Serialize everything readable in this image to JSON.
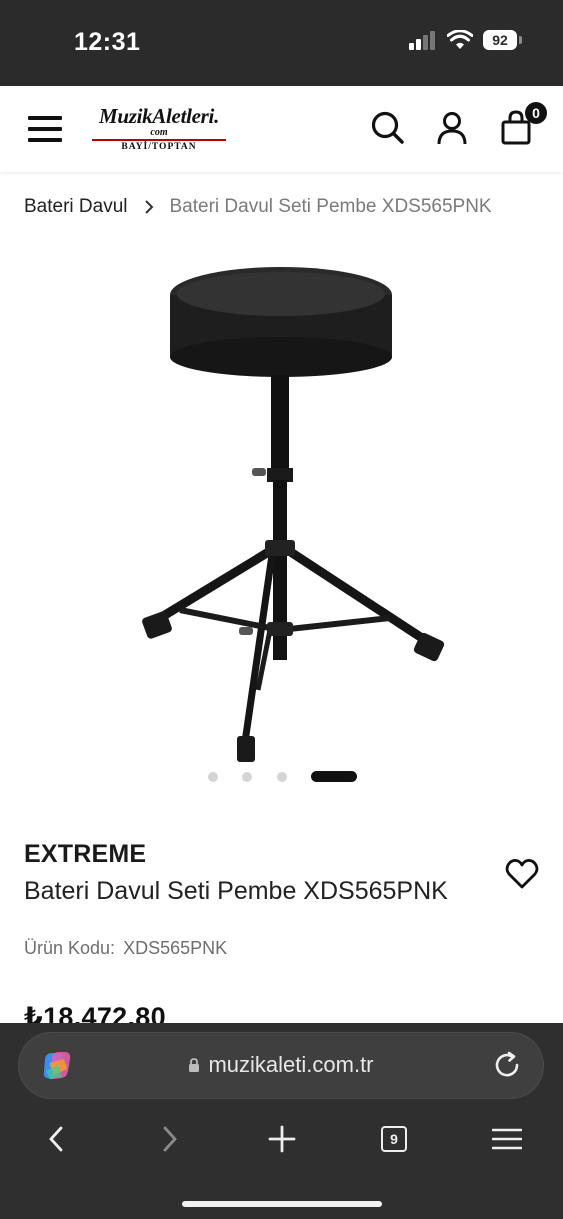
{
  "status_bar": {
    "time": "12:31",
    "battery": "92"
  },
  "header": {
    "logo_main": "MuzikAletleri.",
    "logo_com": "com",
    "logo_sub": "BAYİ/TOPTAN",
    "cart_count": "0"
  },
  "breadcrumb": {
    "parent": "Bateri Davul",
    "current": "Bateri Davul Seti Pembe XDS565PNK"
  },
  "carousel": {
    "slide_count": 4,
    "active_index": 3
  },
  "product": {
    "brand": "EXTREME",
    "title": "Bateri Davul Seti Pembe XDS565PNK",
    "sku_label": "Ürün Kodu:",
    "sku_value": "XDS565PNK",
    "price": "₺18.472,80"
  },
  "browser": {
    "url": "muzikaleti.com.tr",
    "tab_count": "9"
  },
  "colors": {
    "status_bg": "#2b2b2b",
    "browser_bg": "#2f2f2f",
    "logo_accent": "#b40000"
  }
}
